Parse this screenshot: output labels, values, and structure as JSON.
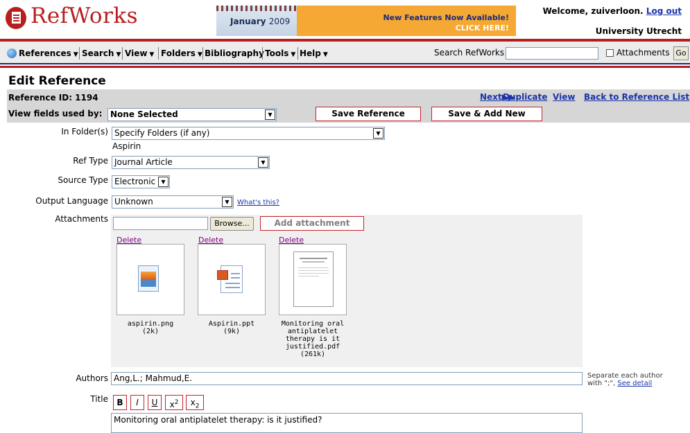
{
  "header": {
    "logo_text": "RefWorks",
    "banner": {
      "month": "January",
      "year": "2009",
      "news_line1": "New Features Now Available!",
      "news_line2": "CLICK HERE!"
    },
    "welcome_text": "Welcome, zuiverloon.",
    "logout_label": "Log out",
    "institution": "University Utrecht"
  },
  "nav": {
    "menus": [
      "References",
      "Search",
      "View",
      "Folders",
      "Bibliography",
      "Tools",
      "Help"
    ],
    "search_label": "Search RefWorks",
    "search_value": "",
    "attachments_label": "Attachments",
    "go_label": "Go"
  },
  "edit": {
    "title": "Edit Reference",
    "ref_id_label": "Reference ID: 1194",
    "links": {
      "next": "Next",
      "duplicate": "Duplicate",
      "view": "View",
      "back": "Back to Reference List"
    },
    "view_fields_label": "View fields used by:",
    "view_fields_value": "None Selected",
    "save_label": "Save Reference",
    "save_add_label": "Save & Add New"
  },
  "fields": {
    "folders_label": "In Folder(s)",
    "folders_value": "Specify Folders (if any)",
    "folder_current": "Aspirin",
    "reftype_label": "Ref Type",
    "reftype_value": "Journal Article",
    "source_label": "Source Type",
    "source_value": "Electronic",
    "lang_label": "Output Language",
    "lang_value": "Unknown",
    "whats_this": "What's this?",
    "attachments_label": "Attachments",
    "browse_label": "Browse...",
    "add_attachment_label": "Add attachment",
    "delete_label": "Delete",
    "files": [
      {
        "name": "aspirin.png",
        "size": "(2k)"
      },
      {
        "name": "Aspirin.ppt",
        "size": "(9k)"
      },
      {
        "name_lines": [
          "Monitoring oral",
          "antiplatelet",
          "therapy is it",
          "justified.pdf"
        ],
        "size": "(261k)"
      }
    ],
    "authors_label": "Authors",
    "authors_value": "Ang,L.; Mahmud,E.",
    "authors_hint_line1": "Separate each author",
    "authors_hint_line2": "with \";\",",
    "see_detail": "See detail",
    "title_label": "Title",
    "format_buttons": [
      "B",
      "I",
      "U",
      "x",
      "x"
    ],
    "sup_label": "2",
    "sub_label": "2",
    "title_value": "Monitoring oral antiplatelet therapy: is it justified?"
  }
}
